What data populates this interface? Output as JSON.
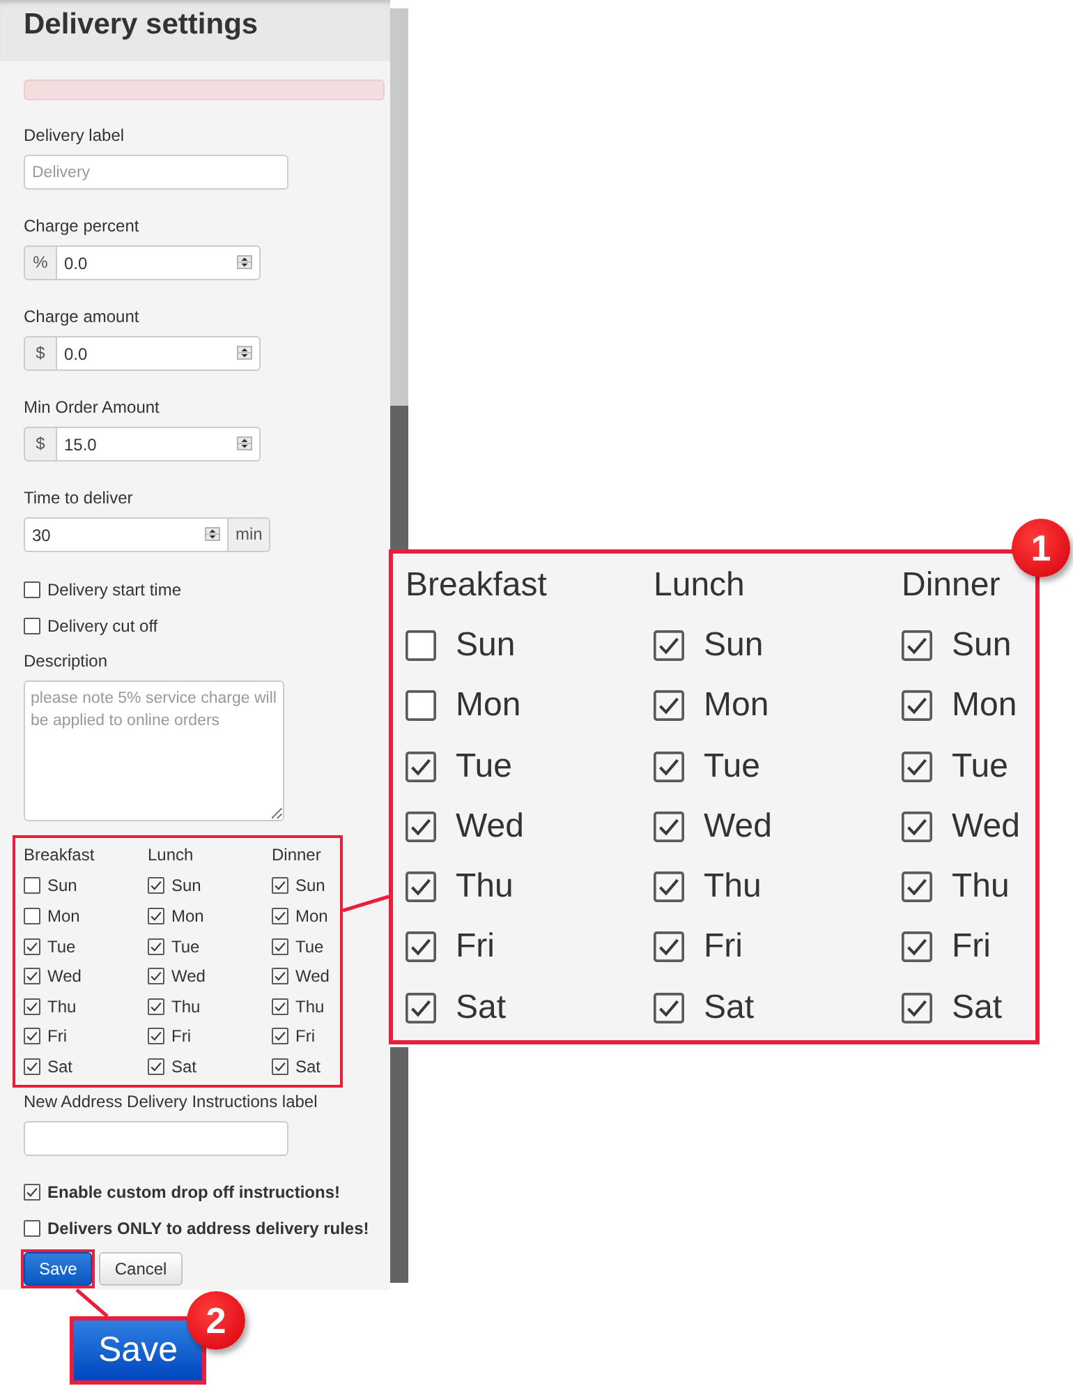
{
  "panel": {
    "title": "Delivery settings",
    "fields": [
      {
        "kind": "text",
        "label": "Delivery label",
        "placeholder": "Delivery"
      },
      {
        "kind": "number",
        "label": "Charge percent",
        "prefix": "%",
        "value": "0.0"
      },
      {
        "kind": "number",
        "label": "Charge amount",
        "prefix": "$",
        "value": "0.0"
      },
      {
        "kind": "number",
        "label": "Min Order Amount",
        "prefix": "$",
        "value": "15.0"
      },
      {
        "kind": "number",
        "label": "Time to deliver",
        "value": "30",
        "suffix": "min"
      },
      {
        "kind": "checkbox",
        "label": "Delivery start time",
        "checked": false
      },
      {
        "kind": "checkbox",
        "label": "Delivery cut off",
        "checked": false
      },
      {
        "kind": "textarea",
        "label": "Description",
        "placeholder": "please note 5% service charge will be applied to online orders"
      }
    ],
    "meal_schedule": {
      "highlighted": true,
      "meals": [
        {
          "meal": "Breakfast",
          "days": [
            {
              "day": "Sun",
              "checked": false
            },
            {
              "day": "Mon",
              "checked": false
            },
            {
              "day": "Tue",
              "checked": true
            },
            {
              "day": "Wed",
              "checked": true
            },
            {
              "day": "Thu",
              "checked": true
            },
            {
              "day": "Fri",
              "checked": true
            },
            {
              "day": "Sat",
              "checked": true
            }
          ]
        },
        {
          "meal": "Lunch",
          "days": [
            {
              "day": "Sun",
              "checked": true
            },
            {
              "day": "Mon",
              "checked": true
            },
            {
              "day": "Tue",
              "checked": true
            },
            {
              "day": "Wed",
              "checked": true
            },
            {
              "day": "Thu",
              "checked": true
            },
            {
              "day": "Fri",
              "checked": true
            },
            {
              "day": "Sat",
              "checked": true
            }
          ]
        },
        {
          "meal": "Dinner",
          "days": [
            {
              "day": "Sun",
              "checked": true
            },
            {
              "day": "Mon",
              "checked": true
            },
            {
              "day": "Tue",
              "checked": true
            },
            {
              "day": "Wed",
              "checked": true
            },
            {
              "day": "Thu",
              "checked": true
            },
            {
              "day": "Fri",
              "checked": true
            },
            {
              "day": "Sat",
              "checked": true
            }
          ]
        }
      ]
    },
    "instructions_field": {
      "label": "New Address Delivery Instructions label"
    },
    "options": [
      {
        "label": "Enable custom drop off instructions!",
        "checked": true
      },
      {
        "label": "Delivers ONLY to address delivery rules!",
        "checked": false
      }
    ],
    "buttons": [
      {
        "label": "Save",
        "kind": "primary",
        "highlighted": true
      },
      {
        "label": "Cancel",
        "kind": "default",
        "highlighted": false
      }
    ]
  },
  "callouts": [
    {
      "kind": "meal_schedule",
      "badge": "1",
      "meals": [
        {
          "meal": "Breakfast",
          "days": [
            {
              "day": "Sun",
              "checked": false
            },
            {
              "day": "Mon",
              "checked": false
            },
            {
              "day": "Tue",
              "checked": true
            },
            {
              "day": "Wed",
              "checked": true
            },
            {
              "day": "Thu",
              "checked": true
            },
            {
              "day": "Fri",
              "checked": true
            },
            {
              "day": "Sat",
              "checked": true
            }
          ]
        },
        {
          "meal": "Lunch",
          "days": [
            {
              "day": "Sun",
              "checked": true
            },
            {
              "day": "Mon",
              "checked": true
            },
            {
              "day": "Tue",
              "checked": true
            },
            {
              "day": "Wed",
              "checked": true
            },
            {
              "day": "Thu",
              "checked": true
            },
            {
              "day": "Fri",
              "checked": true
            },
            {
              "day": "Sat",
              "checked": true
            }
          ]
        },
        {
          "meal": "Dinner",
          "days": [
            {
              "day": "Sun",
              "checked": true
            },
            {
              "day": "Mon",
              "checked": true
            },
            {
              "day": "Tue",
              "checked": true
            },
            {
              "day": "Wed",
              "checked": true
            },
            {
              "day": "Thu",
              "checked": true
            },
            {
              "day": "Fri",
              "checked": true
            },
            {
              "day": "Sat",
              "checked": true
            }
          ]
        }
      ]
    },
    {
      "kind": "button",
      "badge": "2",
      "label": "Save"
    }
  ]
}
